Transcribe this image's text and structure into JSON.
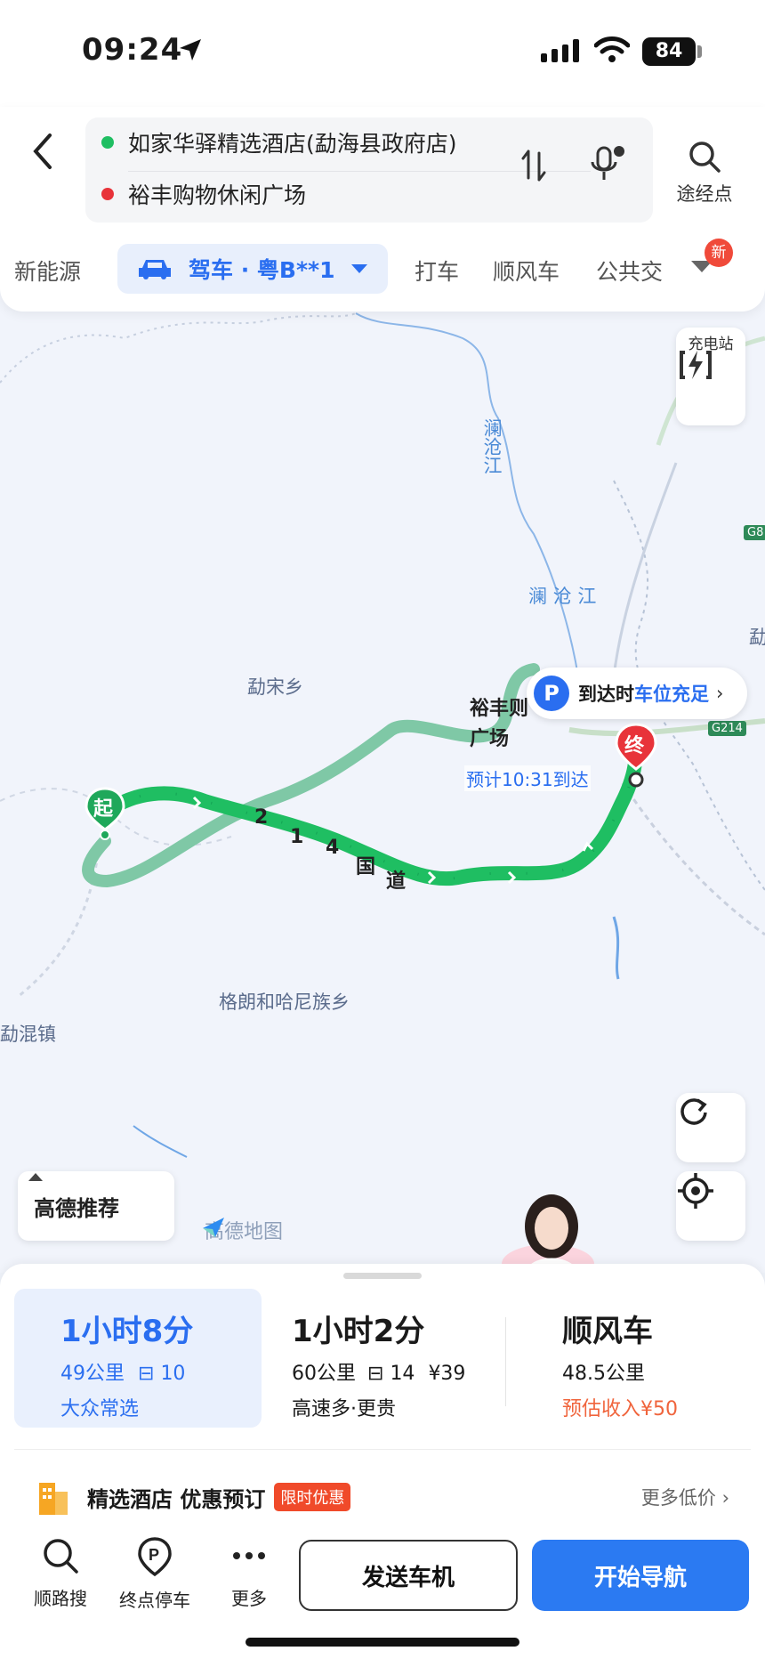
{
  "status_bar": {
    "time": "09:24",
    "battery": "84"
  },
  "header": {
    "origin": "如家华驿精选酒店(勐海县政府店)",
    "destination": "裕丰购物休闲广场",
    "waypoint_label": "途经点",
    "transport_modes": [
      {
        "label": "新能源"
      },
      {
        "label": "驾车 · 粤B**1",
        "active": true
      },
      {
        "label": "打车"
      },
      {
        "label": "顺风车"
      },
      {
        "label": "公共交"
      }
    ],
    "new_badge": "新"
  },
  "map": {
    "places": [
      "勐宋乡",
      "格朗和哈尼族乡",
      "勐混镇"
    ],
    "rivers": [
      "澜沧江",
      "澜 沧 江"
    ],
    "road_label": [
      "2",
      "1",
      "4",
      "国",
      "道"
    ],
    "charger_label": "充电站",
    "parking_bubble": {
      "p": "P",
      "prefix": "到达时",
      "highlight": "车位充足"
    },
    "destination_name": [
      "裕丰则",
      "广场"
    ],
    "eta": "预计10:31到达",
    "start_marker": "起",
    "end_marker": "终",
    "g214": "G214",
    "g8": "G8",
    "edge_label": "勐",
    "recommend_label": "高德推荐",
    "brand": "高德地图",
    "colors": {
      "route_green": "#1fbe62",
      "route_alt": "#7fc8a6",
      "accent_blue": "#2a6ef0"
    }
  },
  "routes": [
    {
      "time": "1小时8分",
      "distance": "49公里",
      "lights": "10",
      "tag": "大众常选",
      "selected": true
    },
    {
      "time": "1小时2分",
      "distance": "60公里",
      "lights": "14",
      "toll": "¥39",
      "tag": "高速多·更贵"
    },
    {
      "time": "顺风车",
      "distance": "48.5公里",
      "tag": "预估收入¥50"
    }
  ],
  "hotel_promo": {
    "title": "精选酒店 优惠预订",
    "tag": "限时优惠",
    "more": "更多低价"
  },
  "toolbar": {
    "search": "顺路搜",
    "parking": "终点停车",
    "more": "更多",
    "send": "发送车机",
    "navigate": "开始导航"
  }
}
